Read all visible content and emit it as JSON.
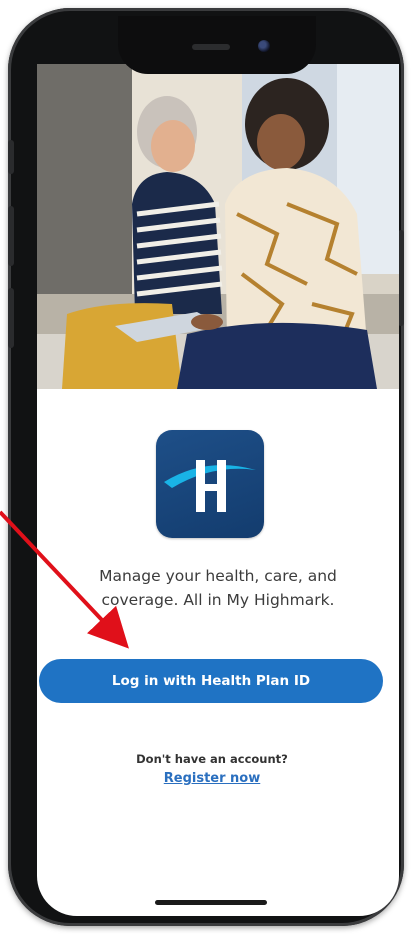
{
  "app": {
    "name": "My Highmark"
  },
  "login_screen": {
    "tagline_line1": "Manage your health, care, and",
    "tagline_line2": "coverage. All in My Highmark.",
    "login_button_label": "Log in with Health Plan ID",
    "no_account_text": "Don't have an account?",
    "register_link_label": "Register now"
  },
  "logo": {
    "letter": "H",
    "background_color": "#174478"
  },
  "colors": {
    "primary_button": "#1f73c4",
    "link": "#2a6fbf",
    "annotation_arrow": "#e0101a"
  },
  "icons": {
    "logo": "highmark-h-logo",
    "annotation": "red-arrow-pointer"
  }
}
